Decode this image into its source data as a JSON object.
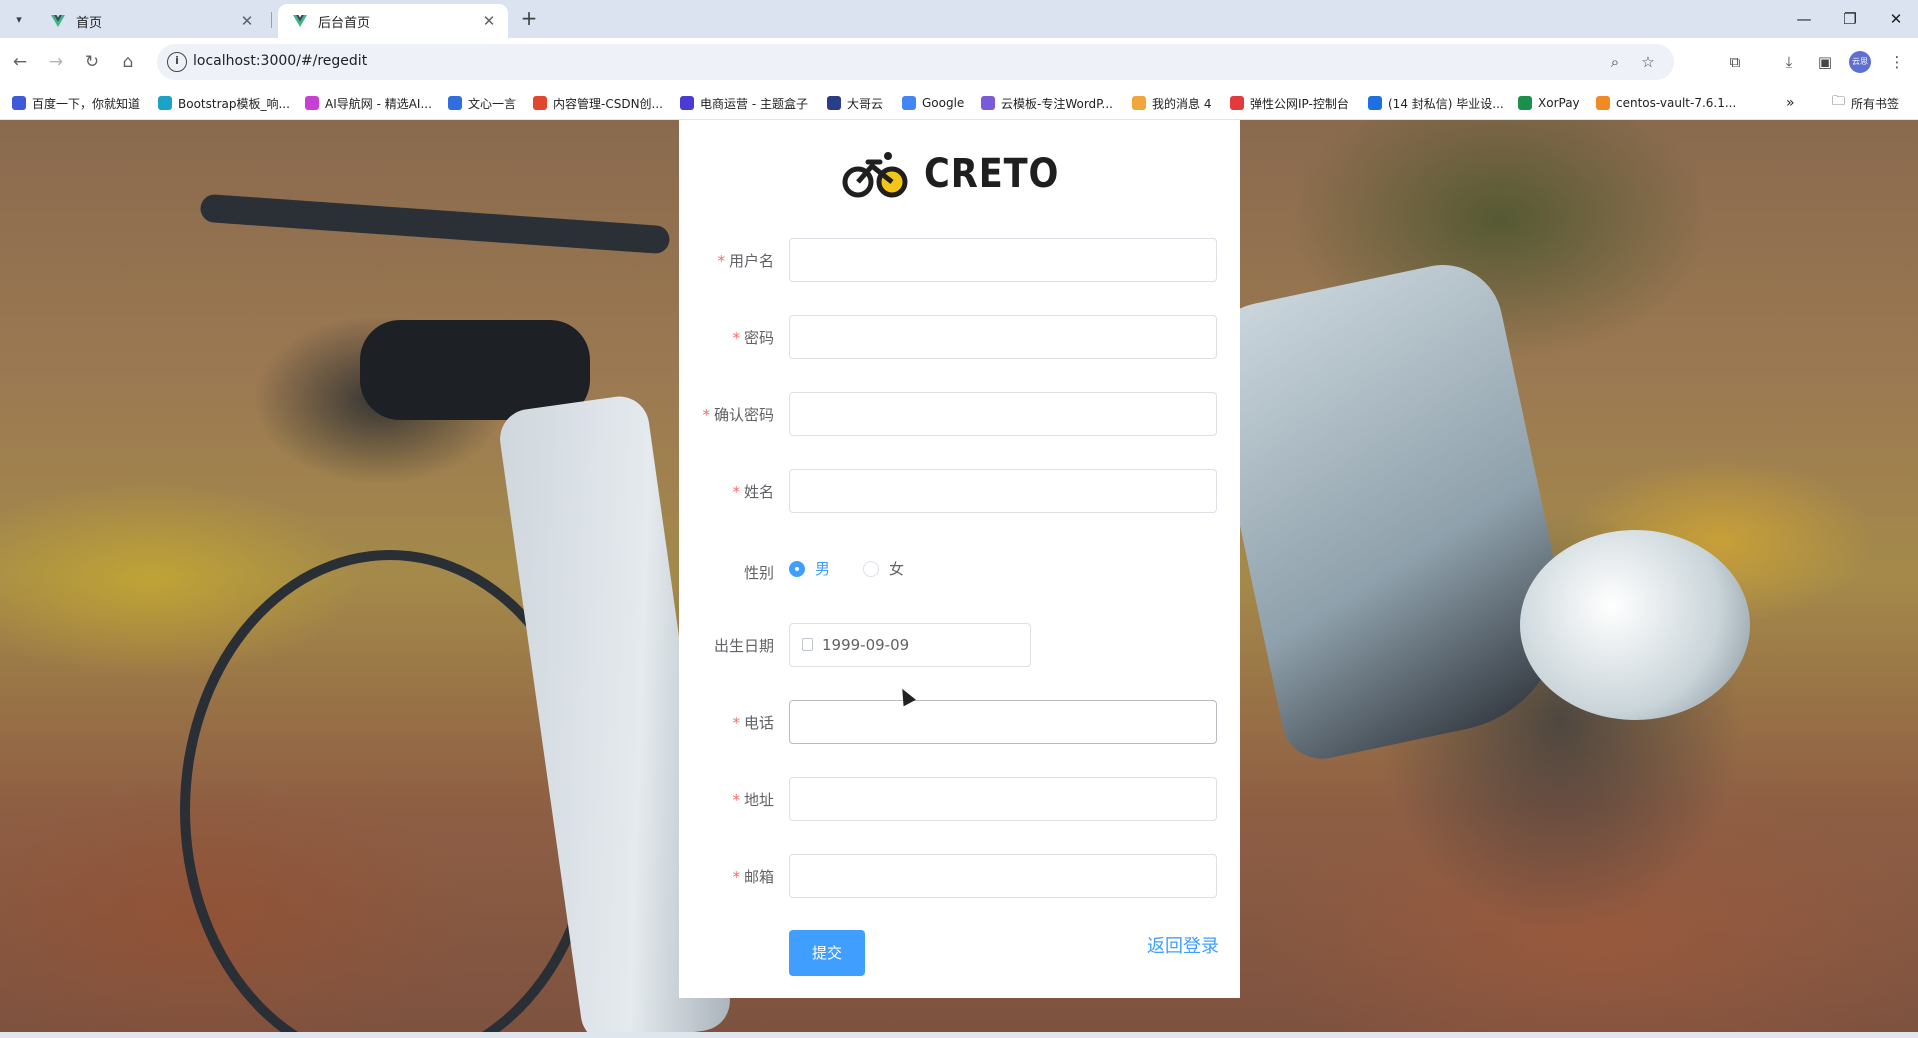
{
  "browser": {
    "tabs": [
      {
        "title": "首页",
        "active": false
      },
      {
        "title": "后台首页",
        "active": true
      }
    ],
    "url": "localhost:3000/#/regedit",
    "profile_label": "云思",
    "bookmarks": [
      {
        "label": "百度一下，你就知道",
        "color": "#3d5bd9"
      },
      {
        "label": "Bootstrap模板_响...",
        "color": "#1aa3c7"
      },
      {
        "label": "AI导航网 - 精选AI...",
        "color": "#c83fd4"
      },
      {
        "label": "文心一言",
        "color": "#2f6fe0"
      },
      {
        "label": "内容管理-CSDN创...",
        "color": "#e0472c"
      },
      {
        "label": "电商运营 - 主题盒子",
        "color": "#4b3bd6"
      },
      {
        "label": "大哥云",
        "color": "#2a3d88"
      },
      {
        "label": "Google",
        "color": "#4285f4"
      },
      {
        "label": "云模板-专注WordP...",
        "color": "#7a5ad6"
      },
      {
        "label": "我的消息 4",
        "color": "#f2a53a"
      },
      {
        "label": "弹性公网IP-控制台",
        "color": "#e23b3b"
      },
      {
        "label": "(14 封私信) 毕业设...",
        "color": "#1e6fe0"
      },
      {
        "label": "XorPay",
        "color": "#1d8f4d"
      },
      {
        "label": "centos-vault-7.6.1...",
        "color": "#f08a24"
      }
    ],
    "all_bookmarks_label": "所有书签"
  },
  "brand": {
    "name": "CRETO"
  },
  "form": {
    "username": {
      "label": "用户名",
      "value": ""
    },
    "password": {
      "label": "密码",
      "value": ""
    },
    "confirm_password": {
      "label": "确认密码",
      "value": ""
    },
    "name": {
      "label": "姓名",
      "value": ""
    },
    "gender": {
      "label": "性别",
      "options": [
        "男",
        "女"
      ],
      "selected": "男"
    },
    "birthday": {
      "label": "出生日期",
      "value": "1999-09-09"
    },
    "phone": {
      "label": "电话",
      "value": ""
    },
    "address": {
      "label": "地址",
      "value": ""
    },
    "email": {
      "label": "邮箱",
      "value": ""
    },
    "submit_label": "提交",
    "back_label": "返回登录"
  },
  "colors": {
    "primary": "#409eff",
    "required": "#f56c6c"
  }
}
